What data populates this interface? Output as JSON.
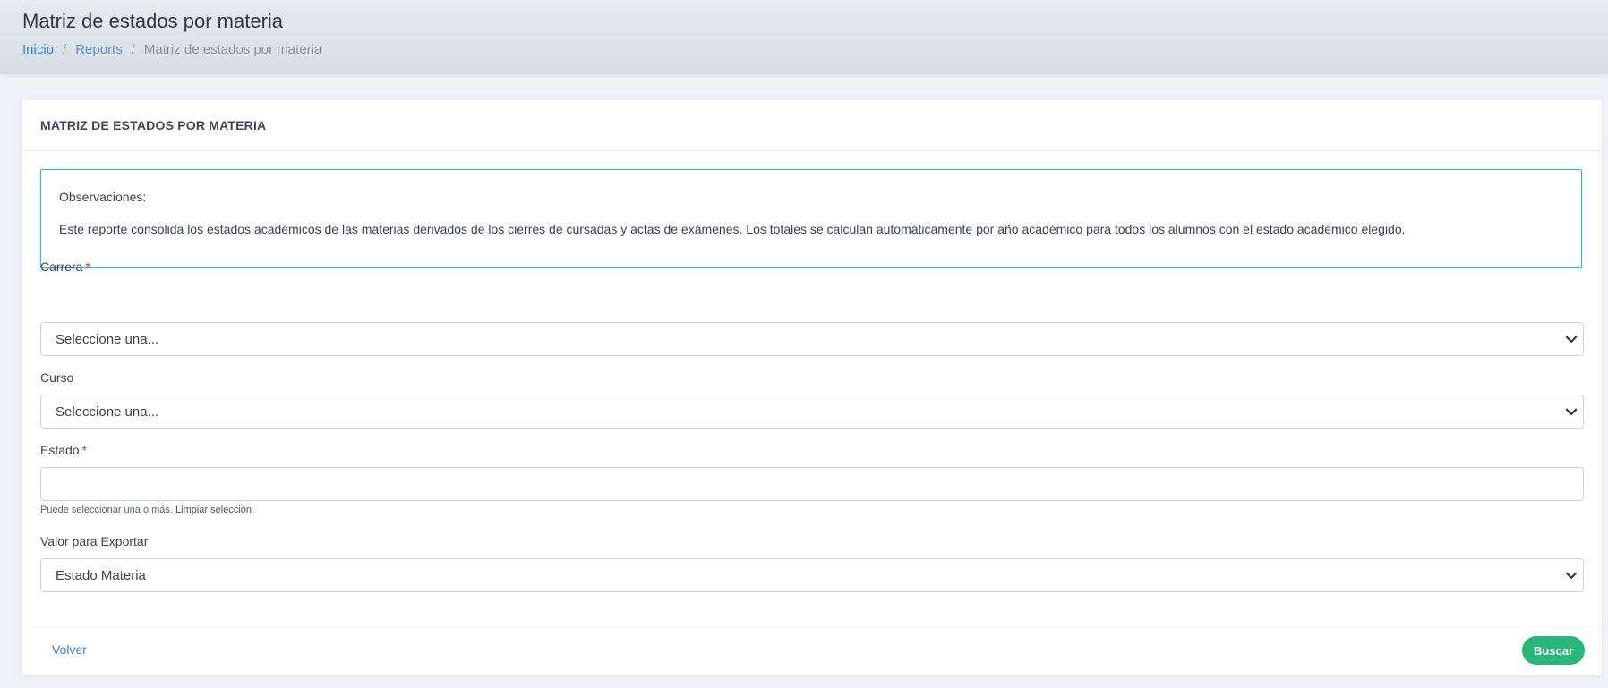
{
  "header": {
    "title": "Matriz de estados por materia",
    "breadcrumb": {
      "home": "Inicio",
      "separator": "/",
      "reports": "Reports",
      "current": "Matriz de estados por materia"
    }
  },
  "card": {
    "title": "MATRIZ DE ESTADOS POR MATERIA",
    "notice": {
      "title": "Observaciones:",
      "body": "Este reporte consolida los estados académicos de las materias derivados de los cierres de cursadas y actas de exámenes. Los totales se calculan automáticamente por año académico para todos los alumnos con el estado académico elegido."
    },
    "fields": {
      "carrera": {
        "label": "Carrera",
        "required_mark": "*",
        "selected": "Seleccione una..."
      },
      "curso": {
        "label": "Curso",
        "selected": "Seleccione una..."
      },
      "estado": {
        "label": "Estado",
        "required_mark": "*",
        "value": "",
        "help": "Puede seleccionar una o más.",
        "help_link": "Limpiar selección"
      },
      "valor_exportar": {
        "label": "Valor para Exportar",
        "selected": "Estado Materia"
      }
    },
    "footer": {
      "back_label": "Volver",
      "search_label": "Buscar"
    }
  },
  "colors": {
    "accent_blue": "#3b7ddd",
    "notice_border": "#2bb2ea",
    "required_red": "#e0343b",
    "search_green": "#28b67a"
  }
}
